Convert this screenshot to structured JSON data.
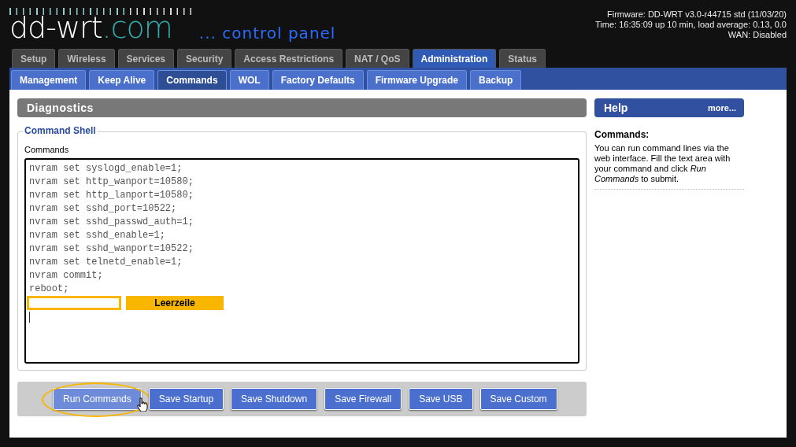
{
  "header": {
    "firmware": "Firmware: DD-WRT v3.0-r44715 std (11/03/20)",
    "time": "Time: 16:35:09 up 10 min, load average: 0.13, 0.0",
    "wan": "WAN: Disabled"
  },
  "logo": {
    "name": "dd-wrt",
    "suffix": ".com",
    "tagline": "... control panel"
  },
  "tabs": [
    {
      "label": "Setup",
      "selected": false
    },
    {
      "label": "Wireless",
      "selected": false
    },
    {
      "label": "Services",
      "selected": false
    },
    {
      "label": "Security",
      "selected": false
    },
    {
      "label": "Access Restrictions",
      "selected": false
    },
    {
      "label": "NAT / QoS",
      "selected": false
    },
    {
      "label": "Administration",
      "selected": true
    },
    {
      "label": "Status",
      "selected": false
    }
  ],
  "subtabs": [
    {
      "label": "Management",
      "selected": false
    },
    {
      "label": "Keep Alive",
      "selected": false
    },
    {
      "label": "Commands",
      "selected": true
    },
    {
      "label": "WOL",
      "selected": false
    },
    {
      "label": "Factory Defaults",
      "selected": false
    },
    {
      "label": "Firmware Upgrade",
      "selected": false
    },
    {
      "label": "Backup",
      "selected": false
    }
  ],
  "section_title": "Diagnostics",
  "fieldset": {
    "legend": "Command Shell",
    "label": "Commands",
    "lines": [
      "nvram set syslogd_enable=1;",
      "nvram set http_wanport=10580;",
      "nvram set http_lanport=10580;",
      "nvram set sshd_port=10522;",
      "nvram set sshd_passwd_auth=1;",
      "nvram set sshd_enable=1;",
      "nvram set sshd_wanport=10522;",
      "nvram set telnetd_enable=1;",
      "nvram commit;",
      "reboot;"
    ],
    "annotation": "Leerzeile"
  },
  "buttons": [
    {
      "label": "Run Commands",
      "highlighted": true
    },
    {
      "label": "Save Startup",
      "highlighted": false
    },
    {
      "label": "Save Shutdown",
      "highlighted": false
    },
    {
      "label": "Save Firewall",
      "highlighted": false
    },
    {
      "label": "Save USB",
      "highlighted": false
    },
    {
      "label": "Save Custom",
      "highlighted": false
    }
  ],
  "help": {
    "title": "Help",
    "more": "more...",
    "heading": "Commands:",
    "text": "You can run command lines via the web interface. Fill the text area with your command and click *Run Commands* to submit."
  }
}
